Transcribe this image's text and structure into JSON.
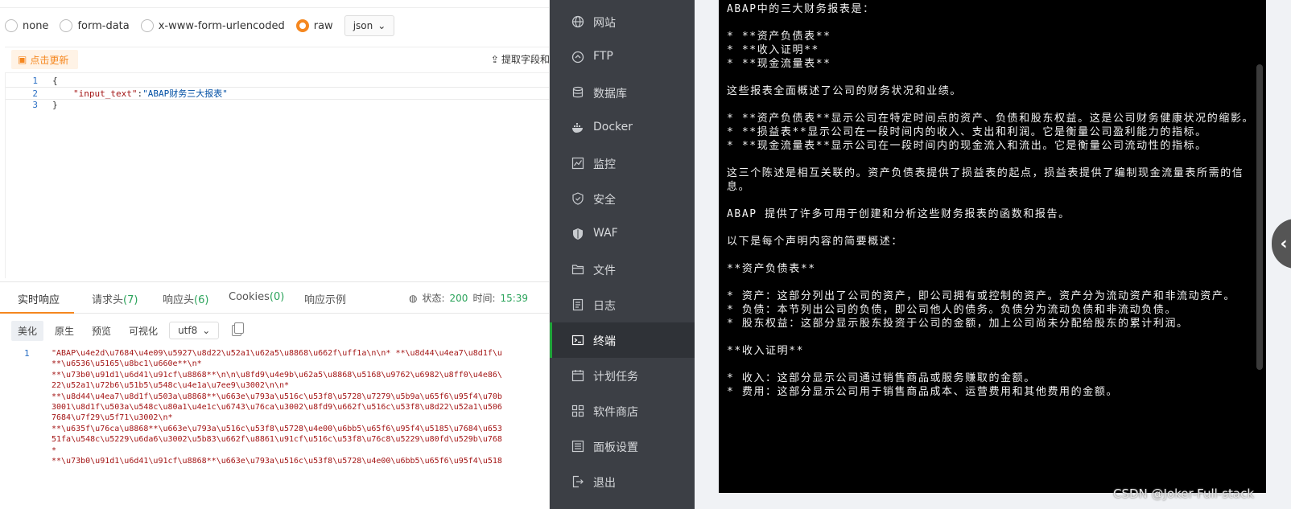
{
  "body_types": {
    "options": [
      "none",
      "form-data",
      "x-www-form-urlencoded",
      "raw"
    ],
    "selected": "raw",
    "format": "json"
  },
  "request": {
    "refresh_label": "点击更新",
    "extract_label": "提取字段和",
    "lines": [
      {
        "n": "1",
        "code": "{"
      },
      {
        "n": "2",
        "key": "\"input_text\"",
        "sep": ":",
        "value": "\"ABAP财务三大报表\""
      },
      {
        "n": "3",
        "code": "}"
      }
    ]
  },
  "response": {
    "tabs": [
      {
        "label": "实时响应",
        "count": ""
      },
      {
        "label": "请求头",
        "count": "(7)"
      },
      {
        "label": "响应头",
        "count": "(6)"
      },
      {
        "label": "Cookies",
        "count": "(0)"
      },
      {
        "label": "响应示例",
        "count": ""
      }
    ],
    "status_label": "状态:",
    "status_value": "200",
    "time_label": "时间:",
    "time_value": "15:39",
    "view_modes": [
      "美化",
      "原生",
      "预览",
      "可视化"
    ],
    "encoding": "utf8",
    "line_number": "1",
    "body_lines": [
      "\"ABAP\\u4e2d\\u7684\\u4e09\\u5927\\u8d22\\u52a1\\u62a5\\u8868\\u662f\\uff1a\\n\\n* **\\u8d44\\u4ea7\\u8d1f\\u",
      "**\\u6536\\u5165\\u8bc1\\u660e**\\n*",
      "**\\u73b0\\u91d1\\u6d41\\u91cf\\u8868**\\n\\n\\u8fd9\\u4e9b\\u62a5\\u8868\\u5168\\u9762\\u6982\\u8ff0\\u4e86\\",
      "22\\u52a1\\u72b6\\u51b5\\u548c\\u4e1a\\u7ee9\\u3002\\n\\n*",
      "**\\u8d44\\u4ea7\\u8d1f\\u503a\\u8868**\\u663e\\u793a\\u516c\\u53f8\\u5728\\u7279\\u5b9a\\u65f6\\u95f4\\u70b",
      "3001\\u8d1f\\u503a\\u548c\\u80a1\\u4e1c\\u6743\\u76ca\\u3002\\u8fd9\\u662f\\u516c\\u53f8\\u8d22\\u52a1\\u506",
      "7684\\u7f29\\u5f71\\u3002\\n*",
      "**\\u635f\\u76ca\\u8868**\\u663e\\u793a\\u516c\\u53f8\\u5728\\u4e00\\u6bb5\\u65f6\\u95f4\\u5185\\u7684\\u653",
      "51fa\\u548c\\u5229\\u6da6\\u3002\\u5b83\\u662f\\u8861\\u91cf\\u516c\\u53f8\\u76c8\\u5229\\u80fd\\u529b\\u768",
      "*",
      "**\\u73b0\\u91d1\\u6d41\\u91cf\\u8868**\\u663e\\u793a\\u516c\\u53f8\\u5728\\u4e00\\u6bb5\\u65f6\\u95f4\\u518"
    ]
  },
  "sidebar": {
    "items": [
      {
        "label": "网站",
        "icon": "globe-icon"
      },
      {
        "label": "FTP",
        "icon": "ftp-icon"
      },
      {
        "label": "数据库",
        "icon": "database-icon"
      },
      {
        "label": "Docker",
        "icon": "docker-icon"
      },
      {
        "label": "监控",
        "icon": "monitor-icon"
      },
      {
        "label": "安全",
        "icon": "shield-icon"
      },
      {
        "label": "WAF",
        "icon": "waf-shield-icon"
      },
      {
        "label": "文件",
        "icon": "folder-icon"
      },
      {
        "label": "日志",
        "icon": "log-icon"
      },
      {
        "label": "终端",
        "icon": "terminal-icon"
      },
      {
        "label": "计划任务",
        "icon": "calendar-icon"
      },
      {
        "label": "软件商店",
        "icon": "apps-icon"
      },
      {
        "label": "面板设置",
        "icon": "settings-icon"
      },
      {
        "label": "退出",
        "icon": "logout-icon"
      }
    ],
    "active": "终端"
  },
  "terminal": {
    "text": "ABAP中的三大财务报表是：\n\n* **资产负债表**\n* **收入证明**\n* **现金流量表**\n\n这些报表全面概述了公司的财务状况和业绩。\n\n* **资产负债表**显示公司在特定时间点的资产、负债和股东权益。这是公司财务健康状况的缩影。\n* **损益表**显示公司在一段时间内的收入、支出和利润。它是衡量公司盈利能力的指标。\n* **现金流量表**显示公司在一段时间内的现金流入和流出。它是衡量公司流动性的指标。\n\n这三个陈述是相互关联的。资产负债表提供了损益表的起点，损益表提供了编制现金流量表所需的信息。\n\nABAP 提供了许多可用于创建和分析这些财务报表的函数和报告。\n\n以下是每个声明内容的简要概述：\n\n**资产负债表**\n\n* 资产：这部分列出了公司的资产，即公司拥有或控制的资产。资产分为流动资产和非流动资产。\n* 负债：本节列出公司的负债，即公司他人的债务。负债分为流动负债和非流动负债。\n* 股东权益：这部分显示股东投资于公司的金额，加上公司尚未分配给股东的累计利润。\n\n**收入证明**\n\n* 收入：这部分显示公司通过销售商品或服务赚取的金额。\n* 费用：这部分显示公司用于销售商品成本、运营费用和其他费用的金额。"
  },
  "watermark": "CSDN @Joker-Full-stack"
}
